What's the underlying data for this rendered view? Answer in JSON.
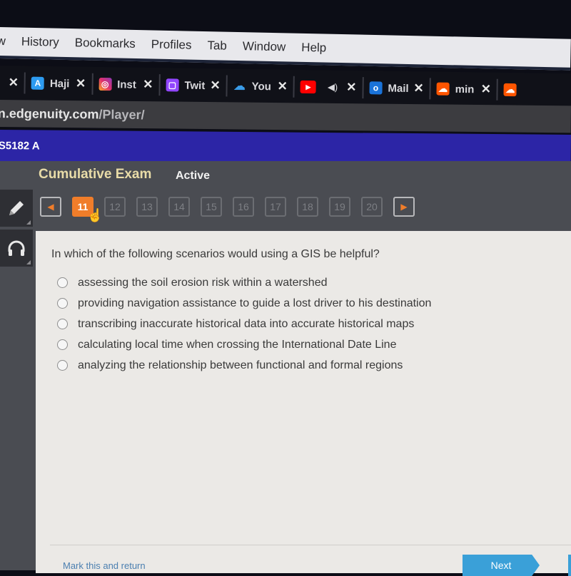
{
  "menubar": {
    "items": [
      "w",
      "History",
      "Bookmarks",
      "Profiles",
      "Tab",
      "Window",
      "Help"
    ]
  },
  "tabs": [
    {
      "title": "",
      "icon": "close-only",
      "color": ""
    },
    {
      "title": "Haji",
      "icon": "a-logo-icon",
      "color": "#2d9bf0",
      "glyph": "A"
    },
    {
      "title": "Inst",
      "icon": "instagram-icon",
      "color": "#e1306c",
      "glyph": "◎"
    },
    {
      "title": "Twit",
      "icon": "twitch-icon",
      "color": "#9146ff",
      "glyph": "▢"
    },
    {
      "title": "You",
      "icon": "cloud-download-icon",
      "color": "#101118",
      "glyph": "☁"
    },
    {
      "title": "",
      "icon": "youtube-icon",
      "color": "#ff0000",
      "glyph": "▶",
      "extra": "◀)"
    },
    {
      "title": "Mail",
      "icon": "outlook-icon",
      "color": "#1a73d9",
      "glyph": "o"
    },
    {
      "title": "min",
      "icon": "soundcloud-icon",
      "color": "#ff5500",
      "glyph": "☁"
    },
    {
      "title": "",
      "icon": "soundcloud-icon",
      "color": "#ff5500",
      "glyph": "☁"
    }
  ],
  "address": {
    "host": "n.edgenuity.com",
    "path": "/Player/"
  },
  "course": {
    "code": "S5182 A"
  },
  "exam": {
    "title": "Cumulative Exam",
    "status": "Active",
    "prev_label": "◀",
    "next_label": "▶",
    "questions": [
      "11",
      "12",
      "13",
      "14",
      "15",
      "16",
      "17",
      "18",
      "19",
      "20"
    ],
    "current": "11"
  },
  "question": {
    "prompt": "In which of the following scenarios would using a GIS be helpful?",
    "options": [
      "assessing the soil erosion risk within a watershed",
      "providing navigation assistance to guide a lost driver to his destination",
      "transcribing inaccurate historical data into accurate historical maps",
      "calculating local time when crossing the International Date Line",
      "analyzing the relationship between functional and formal regions"
    ]
  },
  "footer": {
    "mark_label": "Mark this and return",
    "next_label": "Next"
  }
}
